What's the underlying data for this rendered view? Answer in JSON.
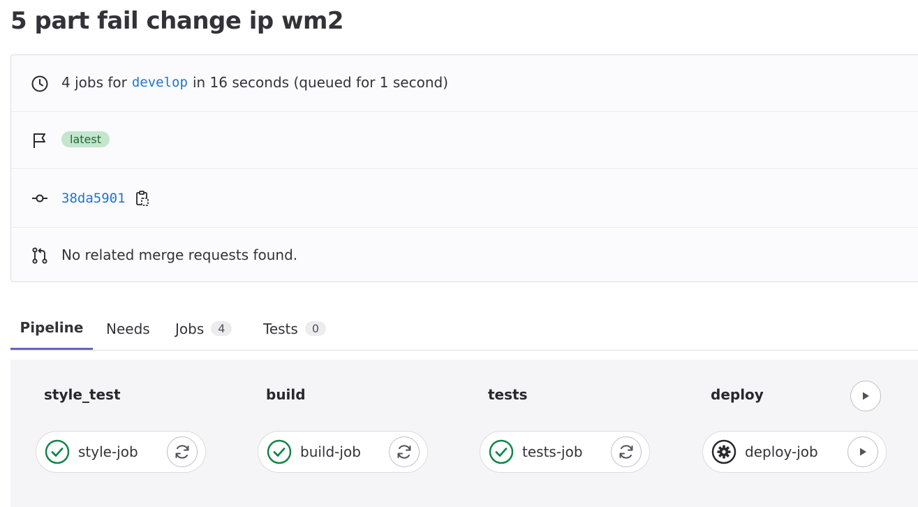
{
  "page": {
    "title": "5 part fail change ip wm2"
  },
  "info": {
    "jobs_prefix": "4 jobs for",
    "branch": "develop",
    "jobs_suffix": "in 16 seconds (queued for 1 second)",
    "badge": "latest",
    "commit_sha": "38da5901",
    "merge_requests": "No related merge requests found."
  },
  "tabs": [
    {
      "label": "Pipeline",
      "active": true
    },
    {
      "label": "Needs",
      "active": false
    },
    {
      "label": "Jobs",
      "count": "4",
      "active": false
    },
    {
      "label": "Tests",
      "count": "0",
      "active": false
    }
  ],
  "stages": [
    {
      "name": "style_test",
      "job": {
        "name": "style-job",
        "status": "success",
        "action": "retry"
      }
    },
    {
      "name": "build",
      "job": {
        "name": "build-job",
        "status": "success",
        "action": "retry"
      }
    },
    {
      "name": "tests",
      "job": {
        "name": "tests-job",
        "status": "success",
        "action": "retry"
      }
    },
    {
      "name": "deploy",
      "job": {
        "name": "deploy-job",
        "status": "manual",
        "action": "play"
      }
    }
  ],
  "colors": {
    "success": "#108548",
    "link": "#1f75cb",
    "tab_active": "#6666c4"
  },
  "icons": {
    "clock": "clock-icon",
    "flag": "flag-icon",
    "commit": "commit-icon",
    "merge_request": "merge-request-icon",
    "copy": "copy-to-clipboard-icon",
    "success": "status-success-icon",
    "manual": "status-manual-icon",
    "retry": "retry-icon",
    "play": "play-icon"
  }
}
